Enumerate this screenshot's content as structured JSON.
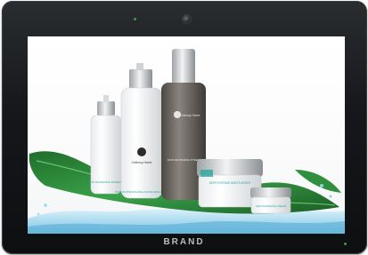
{
  "device": {
    "brand_label": "BRAND"
  },
  "ad": {
    "brand_script": "Cellcosy Home",
    "product_labels": [
      "SKIN WHITENING ESSENCE",
      "SKIN WHITENING BALANCING EMULSION",
      "SKIN WHITENING TONER",
      "DEEP INTENSE MOISTURIZER",
      "SKIN WHITENING CREAM"
    ]
  },
  "colors": {
    "bezel": "#16181b",
    "leaf_green": "#2e8a3a",
    "water": "#9fd6ee",
    "amber_bottle": "#6f6a64",
    "accent_teal": "#2aa7a0"
  }
}
